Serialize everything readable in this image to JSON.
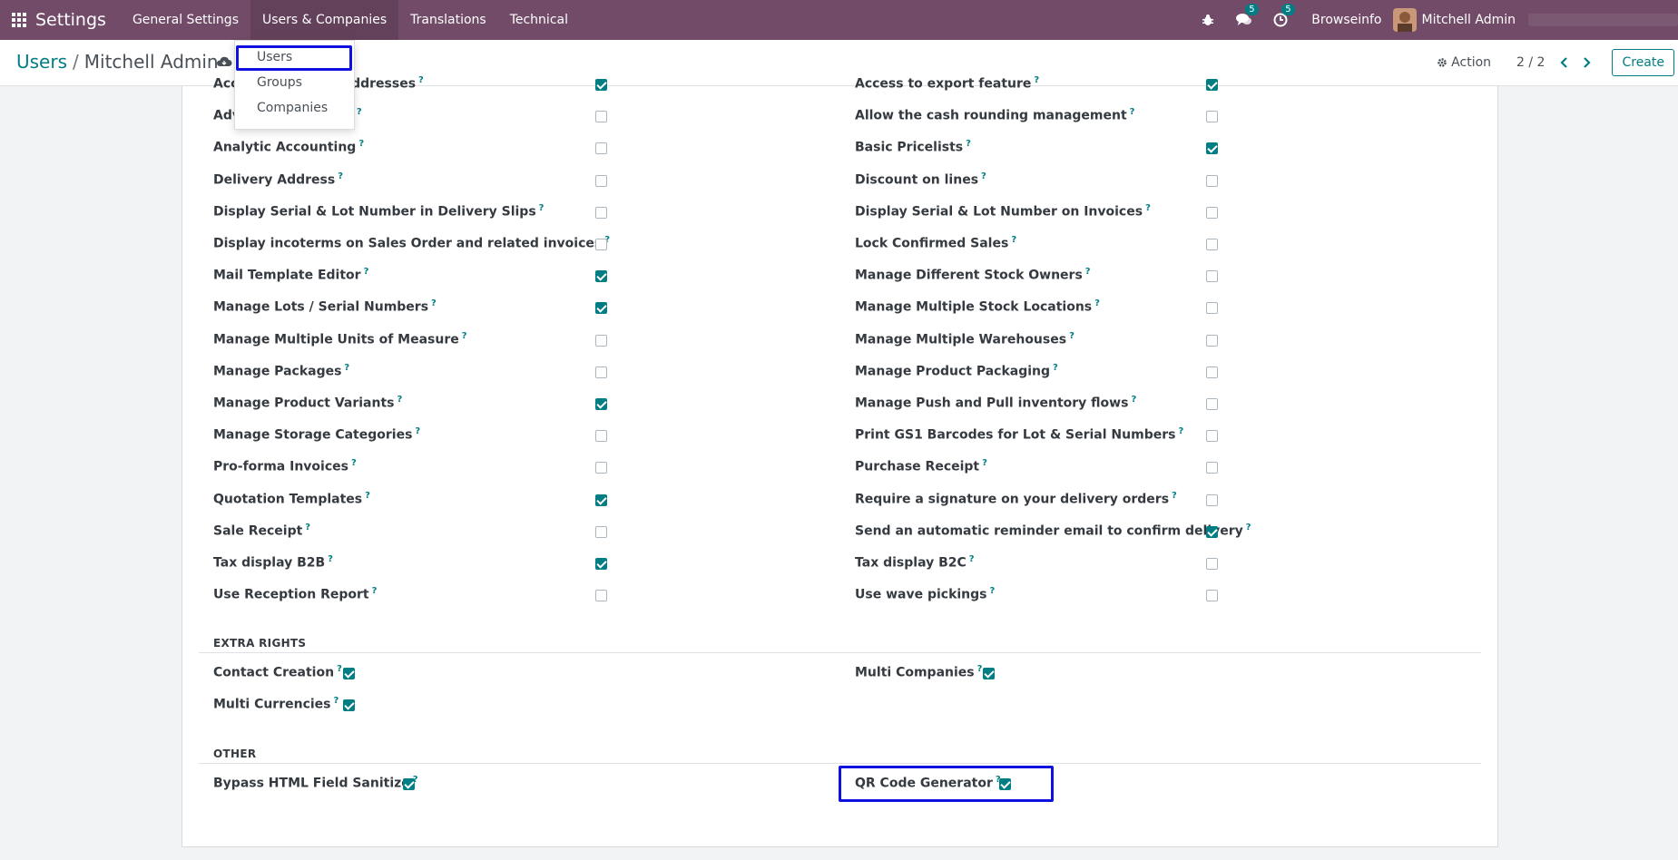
{
  "navbar": {
    "brand": "Settings",
    "menus": [
      "General Settings",
      "Users & Companies",
      "Translations",
      "Technical"
    ],
    "messages_badge": "5",
    "activities_badge": "5",
    "company": "Browseinfo",
    "user": "Mitchell Admin",
    "bg_color": "#714b67"
  },
  "control_panel": {
    "breadcrumb_parent": "Users",
    "breadcrumb_sep": "/",
    "breadcrumb_current": "Mitchell Admin",
    "action_label": "Action",
    "pager": "2 / 2",
    "create_label": "Create"
  },
  "dropdown": {
    "items": [
      "Users",
      "Groups",
      "Companies"
    ]
  },
  "left_rights": [
    {
      "label": "Access to Private Addresses",
      "checked": true
    },
    {
      "label": "Advanced Pricelists",
      "checked": false
    },
    {
      "label": "Analytic Accounting",
      "checked": false
    },
    {
      "label": "Delivery Address",
      "checked": false
    },
    {
      "label": "Display Serial & Lot Number in Delivery Slips",
      "checked": false
    },
    {
      "label": "Display incoterms on Sales Order and related invoices",
      "checked": false
    },
    {
      "label": "Mail Template Editor",
      "checked": true
    },
    {
      "label": "Manage Lots / Serial Numbers",
      "checked": true
    },
    {
      "label": "Manage Multiple Units of Measure",
      "checked": false
    },
    {
      "label": "Manage Packages",
      "checked": false
    },
    {
      "label": "Manage Product Variants",
      "checked": true
    },
    {
      "label": "Manage Storage Categories",
      "checked": false
    },
    {
      "label": "Pro-forma Invoices",
      "checked": false
    },
    {
      "label": "Quotation Templates",
      "checked": true
    },
    {
      "label": "Sale Receipt",
      "checked": false
    },
    {
      "label": "Tax display B2B",
      "checked": true
    },
    {
      "label": "Use Reception Report",
      "checked": false
    }
  ],
  "right_rights": [
    {
      "label": "Access to export feature",
      "checked": true
    },
    {
      "label": "Allow the cash rounding management",
      "checked": false
    },
    {
      "label": "Basic Pricelists",
      "checked": true
    },
    {
      "label": "Discount on lines",
      "checked": false
    },
    {
      "label": "Display Serial & Lot Number on Invoices",
      "checked": false
    },
    {
      "label": "Lock Confirmed Sales",
      "checked": false
    },
    {
      "label": "Manage Different Stock Owners",
      "checked": false
    },
    {
      "label": "Manage Multiple Stock Locations",
      "checked": false
    },
    {
      "label": "Manage Multiple Warehouses",
      "checked": false
    },
    {
      "label": "Manage Product Packaging",
      "checked": false
    },
    {
      "label": "Manage Push and Pull inventory flows",
      "checked": false
    },
    {
      "label": "Print GS1 Barcodes for Lot & Serial Numbers",
      "checked": false
    },
    {
      "label": "Purchase Receipt",
      "checked": false
    },
    {
      "label": "Require a signature on your delivery orders",
      "checked": false
    },
    {
      "label": "Send an automatic reminder email to confirm delivery",
      "checked": true
    },
    {
      "label": "Tax display B2C",
      "checked": false
    },
    {
      "label": "Use wave pickings",
      "checked": false
    }
  ],
  "extra_rights": {
    "title": "EXTRA RIGHTS",
    "items": [
      {
        "label": "Contact Creation",
        "checked": true
      },
      {
        "label": "Multi Currencies",
        "checked": true
      },
      {
        "label": "Multi Companies",
        "checked": true
      }
    ]
  },
  "other": {
    "title": "OTHER",
    "items": [
      {
        "label": "Bypass HTML Field Sanitize",
        "checked": true
      },
      {
        "label": "QR Code Generator",
        "checked": true
      }
    ]
  },
  "accent_color": "#017e84",
  "highlight_color": "#1010e0"
}
